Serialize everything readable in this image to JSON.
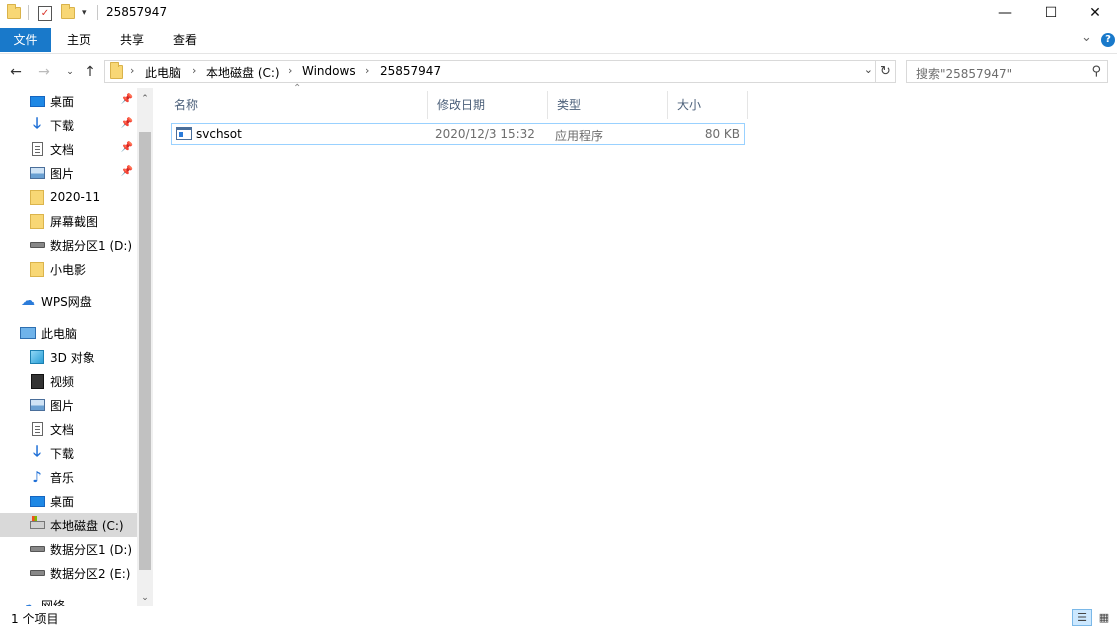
{
  "window": {
    "title": "25857947",
    "controls": {
      "minimize": "—",
      "maximize": "☐",
      "close": "✕"
    }
  },
  "ribbon": {
    "tabs": [
      {
        "label": "文件"
      },
      {
        "label": "主页"
      },
      {
        "label": "共享"
      },
      {
        "label": "查看"
      }
    ],
    "expand_glyph": "⌄",
    "help_glyph": "?"
  },
  "address": {
    "crumbs": [
      "此电脑",
      "本地磁盘 (C:)",
      "Windows",
      "25857947"
    ],
    "search_placeholder": "搜索\"25857947\""
  },
  "nav": {
    "quick_access": [
      {
        "label": "桌面",
        "icon": "desktop-icon",
        "pinned": true
      },
      {
        "label": "下载",
        "icon": "download-icon",
        "pinned": true
      },
      {
        "label": "文档",
        "icon": "document-icon",
        "pinned": true
      },
      {
        "label": "图片",
        "icon": "picture-icon",
        "pinned": true
      },
      {
        "label": "2020-11",
        "icon": "folder-icon",
        "pinned": false
      },
      {
        "label": "屏幕截图",
        "icon": "folder-icon",
        "pinned": false
      },
      {
        "label": "数据分区1 (D:)",
        "icon": "drive-icon",
        "pinned": false
      },
      {
        "label": "小电影",
        "icon": "folder-icon",
        "pinned": false
      }
    ],
    "wps": {
      "label": "WPS网盘",
      "icon": "cloud-icon"
    },
    "this_pc": {
      "label": "此电脑",
      "icon": "computer-icon"
    },
    "pc_items": [
      {
        "label": "3D 对象",
        "icon": "3d-objects-icon"
      },
      {
        "label": "视频",
        "icon": "video-icon"
      },
      {
        "label": "图片",
        "icon": "picture-icon"
      },
      {
        "label": "文档",
        "icon": "document-icon"
      },
      {
        "label": "下载",
        "icon": "download-icon"
      },
      {
        "label": "音乐",
        "icon": "music-icon"
      },
      {
        "label": "桌面",
        "icon": "desktop-icon"
      },
      {
        "label": "本地磁盘 (C:)",
        "icon": "system-drive-icon",
        "selected": true
      },
      {
        "label": "数据分区1 (D:)",
        "icon": "drive-icon"
      },
      {
        "label": "数据分区2 (E:)",
        "icon": "drive-icon"
      }
    ],
    "network": {
      "label": "网络",
      "icon": "network-icon"
    }
  },
  "columns": {
    "name": "名称",
    "modified": "修改日期",
    "type": "类型",
    "size": "大小"
  },
  "files": [
    {
      "name": "svchsot",
      "modified": "2020/12/3 15:32",
      "type": "应用程序",
      "size": "80 KB"
    }
  ],
  "status": {
    "item_count": "1 个项目"
  }
}
